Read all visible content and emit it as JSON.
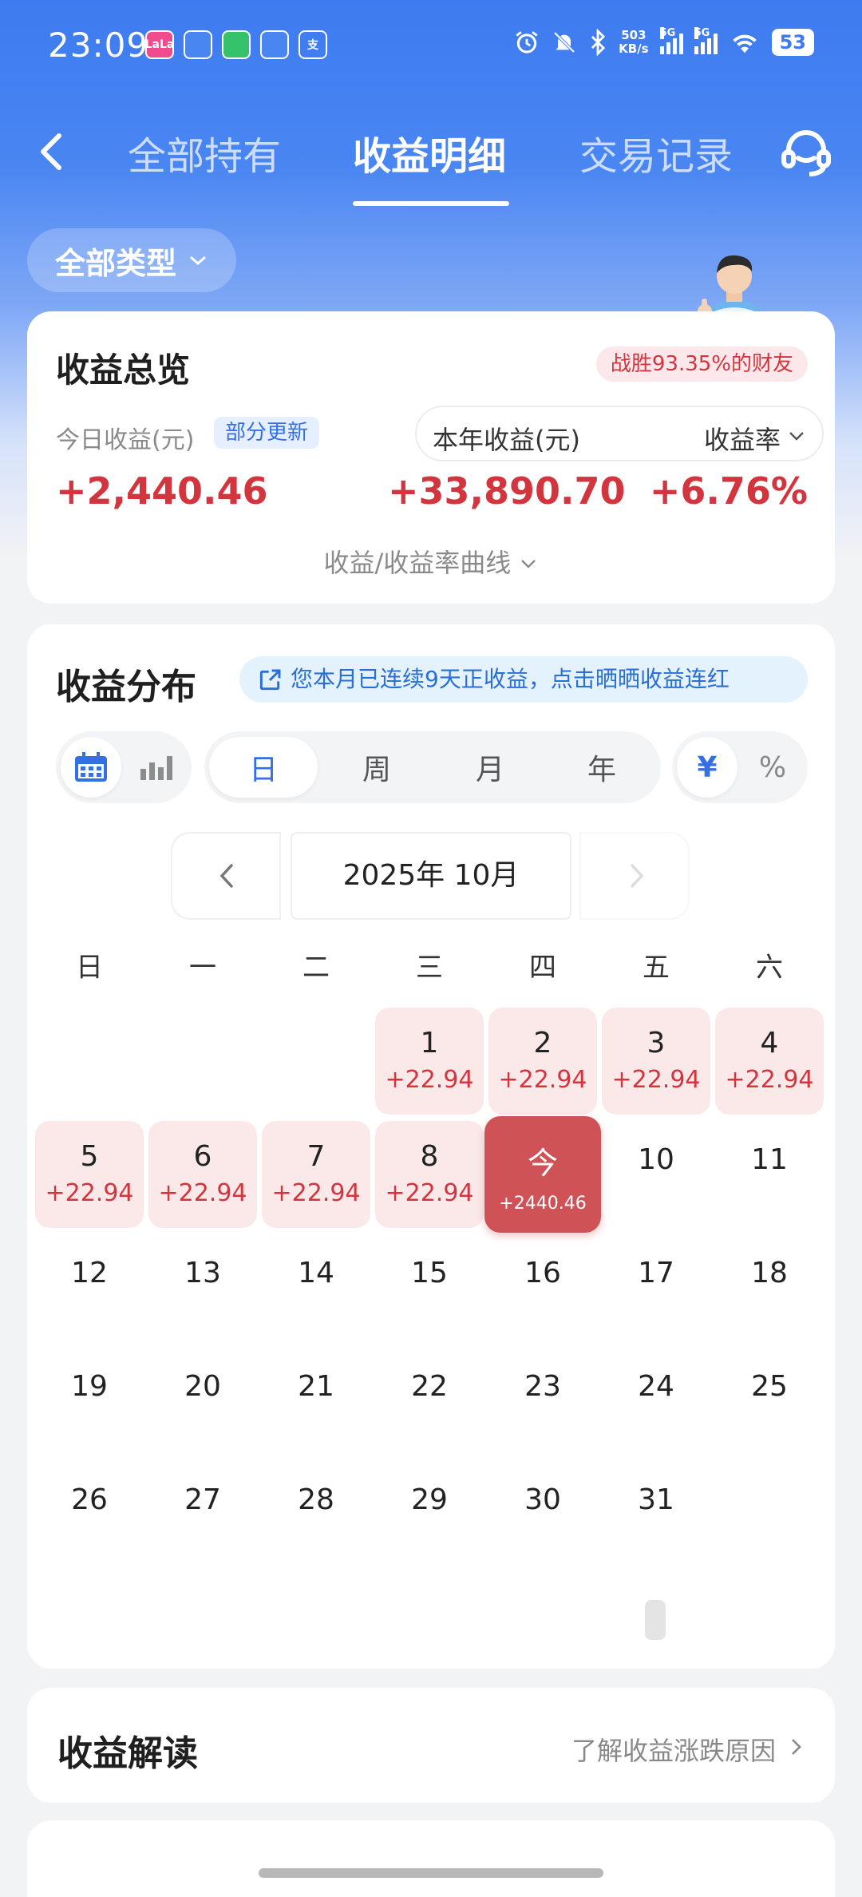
{
  "status_bar": {
    "time": "23:09",
    "app_icons": [
      {
        "name": "lalala-app-icon",
        "text": "LaLa",
        "color": "#f04b8c"
      },
      {
        "name": "bird-app-icon",
        "text": "",
        "color": "#4a86f2"
      },
      {
        "name": "green-app-icon",
        "text": "",
        "color": "#36c26a"
      },
      {
        "name": "play-app-icon",
        "text": "",
        "color": "#4a86f2"
      },
      {
        "name": "alipay-app-icon",
        "text": "支",
        "color": "#ffffff"
      }
    ],
    "net_speed_value": "503",
    "net_speed_unit": "KB/s",
    "signal_1": "5G",
    "signal_2": "5G",
    "battery": "53"
  },
  "nav": {
    "tabs": [
      {
        "label": "全部持有"
      },
      {
        "label": "收益明细"
      },
      {
        "label": "交易记录"
      }
    ],
    "active_tab": 1
  },
  "filter": {
    "label": "全部类型"
  },
  "overview": {
    "title": "收益总览",
    "rank_badge": "战胜93.35%的财友",
    "today_label": "今日收益(元)",
    "partial_badge": "部分更新",
    "year_label": "本年收益(元)",
    "rate_label": "收益率",
    "today_value": "+2,440.46",
    "year_value": "+33,890.70",
    "rate_value": "+6.76%",
    "curve_toggle": "收益/收益率曲线"
  },
  "distribution": {
    "title": "收益分布",
    "banner": "您本月已连续9天正收益，点击晒晒收益连红",
    "periods": [
      "日",
      "周",
      "月",
      "年"
    ],
    "active_period": 0,
    "units": [
      "¥",
      "%"
    ],
    "active_unit": 0,
    "month_label": "2025年 10月",
    "weekdays": [
      "日",
      "一",
      "二",
      "三",
      "四",
      "五",
      "六"
    ],
    "first_weekday": 3,
    "days_in_month": 31,
    "today_label": "今",
    "today_day": 9,
    "today_value": "+2440.46",
    "day_values": {
      "1": "+22.94",
      "2": "+22.94",
      "3": "+22.94",
      "4": "+22.94",
      "5": "+22.94",
      "6": "+22.94",
      "7": "+22.94",
      "8": "+22.94"
    }
  },
  "interpretation": {
    "title": "收益解读",
    "link": "了解收益涨跌原因"
  },
  "colors": {
    "brand_blue": "#3d7bf0",
    "gain_red": "#d2353e",
    "today_cell": "#cf5257",
    "gain_cell_bg": "#fbe9ea"
  }
}
